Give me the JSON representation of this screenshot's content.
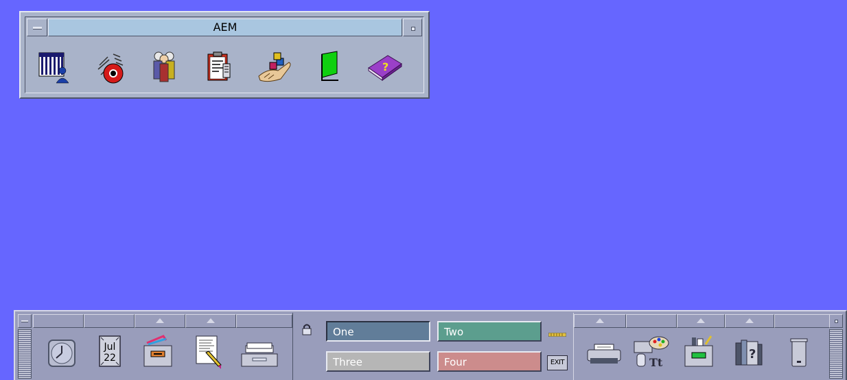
{
  "desktop": {
    "background_color": "#6666ff"
  },
  "aem_subpanel": {
    "title": "AEM",
    "icons": [
      {
        "name": "performance-monitor-icon"
      },
      {
        "name": "alarm-bell-icon"
      },
      {
        "name": "users-icon"
      },
      {
        "name": "clipboard-report-icon"
      },
      {
        "name": "hand-blocks-icon"
      },
      {
        "name": "green-flag-icon"
      },
      {
        "name": "help-book-icon"
      }
    ]
  },
  "front_panel": {
    "left_controls": [
      {
        "name": "clock-icon"
      },
      {
        "name": "calendar-icon",
        "month": "Jul",
        "day": "22"
      },
      {
        "name": "file-manager-icon"
      },
      {
        "name": "text-editor-icon"
      },
      {
        "name": "mailer-icon"
      }
    ],
    "workspaces": [
      {
        "label": "One",
        "color": "#617d99",
        "active": true
      },
      {
        "label": "Two",
        "color": "#5c9e8e",
        "active": false
      },
      {
        "label": "Three",
        "color": "#b6b6b6",
        "active": false
      },
      {
        "label": "Four",
        "color": "#cc8c8c",
        "active": false
      }
    ],
    "exit_label": "EXIT",
    "right_controls": [
      {
        "name": "printer-icon"
      },
      {
        "name": "style-manager-icon"
      },
      {
        "name": "application-manager-icon"
      },
      {
        "name": "help-manager-icon"
      },
      {
        "name": "trash-can-icon"
      }
    ]
  }
}
